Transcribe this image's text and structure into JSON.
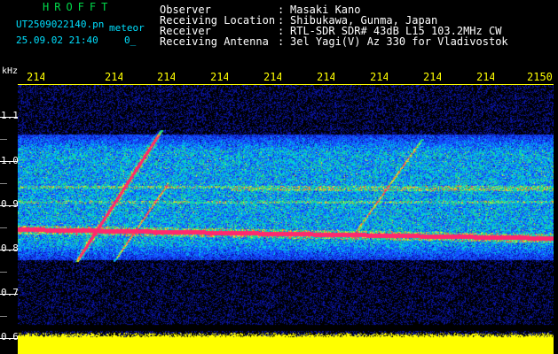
{
  "header": {
    "brand": "HROFFT",
    "filename": "UT2509022140.pn",
    "meteor_label": "meteor",
    "datetime": "25.09.02 21:40",
    "count": "0",
    "count_suffix": "_"
  },
  "meta": [
    {
      "key": "Observer",
      "value": "Masaki Kano"
    },
    {
      "key": "Receiving Location",
      "value": "Shibukawa, Gunma, Japan"
    },
    {
      "key": "Receiver",
      "value": "RTL-SDR SDR# 43dB L15 103.2MHz CW"
    },
    {
      "key": "Receiving Antenna",
      "value": "3el Yagi(V) Az 330 for Vladivostok"
    }
  ],
  "axis": {
    "y_unit": "kHz",
    "x_ticks": [
      "214",
      "214",
      "214",
      "214",
      "214",
      "214",
      "214",
      "214",
      "214",
      "2150"
    ],
    "y_ticks": [
      "1.1",
      "1.0",
      "0.9",
      "0.8",
      "0.7",
      "0.6"
    ]
  },
  "colors": {
    "background": "#000000",
    "title_green": "#00d84a",
    "info_cyan": "#00e0ff",
    "tick_yellow": "#ffff00",
    "band_blue": "#1a2cff",
    "trace_red": "#ff2a60",
    "power_yellow": "#ffff00"
  }
}
